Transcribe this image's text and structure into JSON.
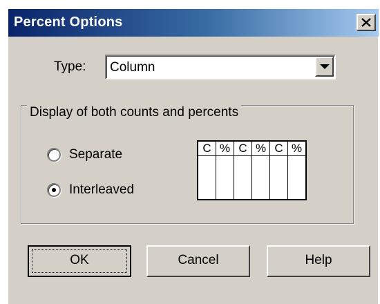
{
  "dialog": {
    "title": "Percent Options"
  },
  "type_field": {
    "label": "Type:",
    "selected": "Column"
  },
  "group": {
    "legend": "Display of both counts and percents",
    "options": [
      {
        "label": "Separate",
        "selected": false
      },
      {
        "label": "Interleaved",
        "selected": true
      }
    ],
    "preview_columns": [
      "C",
      "%",
      "C",
      "%",
      "C",
      "%"
    ]
  },
  "buttons": {
    "ok": "OK",
    "cancel": "Cancel",
    "help": "Help"
  },
  "icons": {
    "close": "close-icon",
    "dropdown": "dropdown-arrow-icon"
  }
}
